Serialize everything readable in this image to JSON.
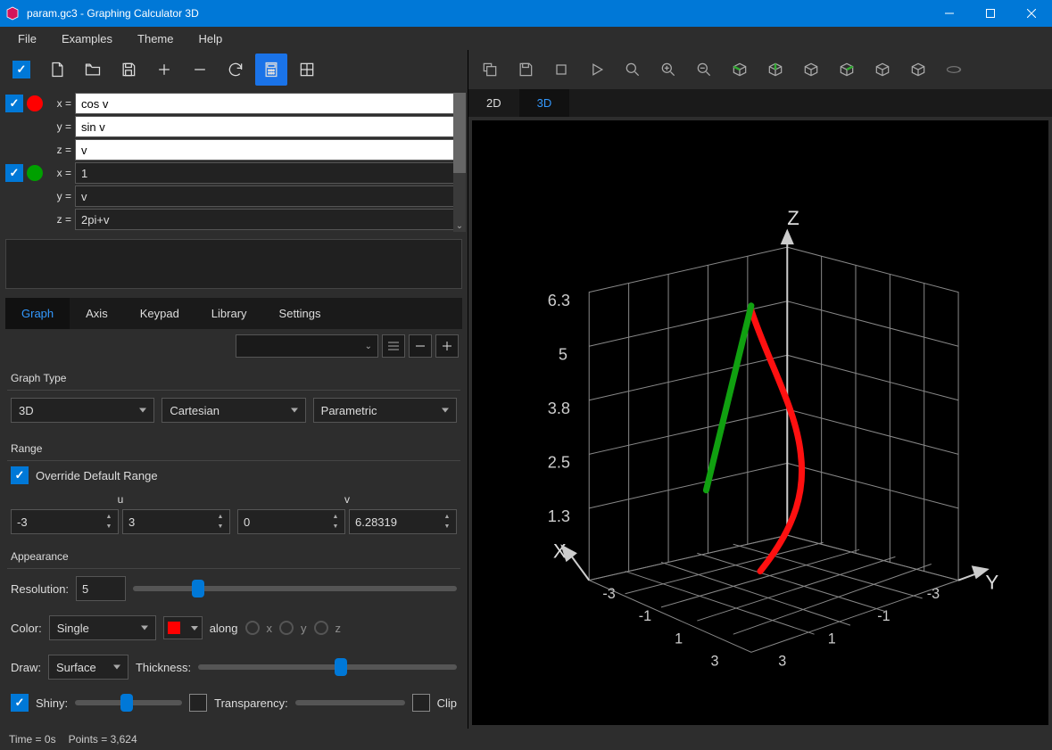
{
  "window": {
    "title": "param.gc3 - Graphing Calculator 3D"
  },
  "menu": [
    "File",
    "Examples",
    "Theme",
    "Help"
  ],
  "equations": [
    {
      "color": "#ff0000",
      "check": true,
      "rows": [
        {
          "var": "x =",
          "val": "cos v",
          "style": "white"
        },
        {
          "var": "y =",
          "val": "sin v",
          "style": "white"
        },
        {
          "var": "z =",
          "val": "v",
          "style": "white"
        }
      ]
    },
    {
      "color": "#00a000",
      "check": true,
      "rows": [
        {
          "var": "x =",
          "val": "1",
          "style": "dark"
        },
        {
          "var": "y =",
          "val": "v",
          "style": "dark"
        },
        {
          "var": "z =",
          "val": "2pi+v",
          "style": "dark"
        }
      ]
    }
  ],
  "tabs": [
    "Graph",
    "Axis",
    "Keypad",
    "Library",
    "Settings"
  ],
  "graphType": {
    "header": "Graph Type",
    "dim": "3D",
    "coord": "Cartesian",
    "ftype": "Parametric"
  },
  "range": {
    "header": "Range",
    "override_label": "Override Default Range",
    "u_label": "u",
    "v_label": "v",
    "u_min": "-3",
    "u_max": "3",
    "v_min": "0",
    "v_max": "6.28319"
  },
  "appearance": {
    "header": "Appearance",
    "resolution_label": "Resolution:",
    "resolution": "5",
    "color_label": "Color:",
    "color_mode": "Single",
    "color_value": "#ff0000",
    "along_label": "along",
    "along_x": "x",
    "along_y": "y",
    "along_z": "z",
    "draw_label": "Draw:",
    "draw_mode": "Surface",
    "thickness_label": "Thickness:",
    "shiny_label": "Shiny:",
    "transparency_label": "Transparency:",
    "clip_label": "Clip"
  },
  "viewtabs": [
    "2D",
    "3D"
  ],
  "axis": {
    "x": "X",
    "y": "Y",
    "z": "Z",
    "z_ticks": [
      "6.3",
      "5",
      "3.8",
      "2.5",
      "1.3"
    ],
    "xy_ticks": [
      "-3",
      "-1",
      "1",
      "3"
    ]
  },
  "status": {
    "time": "Time = 0s",
    "points": "Points = 3,624"
  },
  "icons": {
    "left_toolbar": [
      "checkbox",
      "new-file",
      "open-file",
      "save",
      "plus",
      "minus",
      "refresh",
      "calculator",
      "grid"
    ],
    "right_toolbar": [
      "copy",
      "save",
      "stop",
      "play",
      "zoom",
      "zoom-in",
      "zoom-out",
      "cube-1",
      "cube-2",
      "cube-3",
      "cube-4",
      "cube-5",
      "cube-6",
      "rotate"
    ]
  }
}
